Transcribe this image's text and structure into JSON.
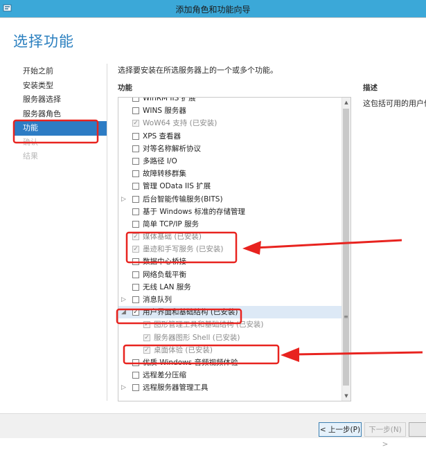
{
  "window": {
    "title": "添加角色和功能向导"
  },
  "page": {
    "title": "选择功能",
    "instruction": "选择要安装在所选服务器上的一个或多个功能。"
  },
  "nav": {
    "items": [
      {
        "label": "开始之前",
        "state": "normal"
      },
      {
        "label": "安装类型",
        "state": "normal"
      },
      {
        "label": "服务器选择",
        "state": "normal"
      },
      {
        "label": "服务器角色",
        "state": "normal"
      },
      {
        "label": "功能",
        "state": "selected"
      },
      {
        "label": "确认",
        "state": "disabled"
      },
      {
        "label": "结果",
        "state": "disabled"
      }
    ]
  },
  "features": {
    "header": "功能",
    "items": [
      {
        "label": "WinRM IIS 扩展",
        "checked": false,
        "disabled": false,
        "indent": 0,
        "expander": ""
      },
      {
        "label": "WINS 服务器",
        "checked": false,
        "disabled": false,
        "indent": 0,
        "expander": ""
      },
      {
        "label": "WoW64 支持 (已安装)",
        "checked": true,
        "disabled": true,
        "indent": 0,
        "expander": ""
      },
      {
        "label": "XPS 查看器",
        "checked": false,
        "disabled": false,
        "indent": 0,
        "expander": ""
      },
      {
        "label": "对等名称解析协议",
        "checked": false,
        "disabled": false,
        "indent": 0,
        "expander": ""
      },
      {
        "label": "多路径 I/O",
        "checked": false,
        "disabled": false,
        "indent": 0,
        "expander": ""
      },
      {
        "label": "故障转移群集",
        "checked": false,
        "disabled": false,
        "indent": 0,
        "expander": ""
      },
      {
        "label": "管理 OData IIS 扩展",
        "checked": false,
        "disabled": false,
        "indent": 0,
        "expander": ""
      },
      {
        "label": "后台智能传输服务(BITS)",
        "checked": false,
        "disabled": false,
        "indent": 0,
        "expander": "collapsed"
      },
      {
        "label": "基于 Windows 标准的存储管理",
        "checked": false,
        "disabled": false,
        "indent": 0,
        "expander": ""
      },
      {
        "label": "简单 TCP/IP 服务",
        "checked": false,
        "disabled": false,
        "indent": 0,
        "expander": ""
      },
      {
        "label": "媒体基础 (已安装)",
        "checked": true,
        "disabled": true,
        "indent": 0,
        "expander": ""
      },
      {
        "label": "墨迹和手写服务 (已安装)",
        "checked": true,
        "disabled": true,
        "indent": 0,
        "expander": ""
      },
      {
        "label": "数据中心桥接",
        "checked": false,
        "disabled": false,
        "indent": 0,
        "expander": ""
      },
      {
        "label": "网络负载平衡",
        "checked": false,
        "disabled": false,
        "indent": 0,
        "expander": ""
      },
      {
        "label": "无线 LAN 服务",
        "checked": false,
        "disabled": false,
        "indent": 0,
        "expander": ""
      },
      {
        "label": "消息队列",
        "checked": false,
        "disabled": false,
        "indent": 0,
        "expander": "collapsed"
      },
      {
        "label": "用户界面和基础结构 (已安装)",
        "checked": true,
        "disabled": false,
        "indent": 0,
        "expander": "expanded",
        "highlight": true
      },
      {
        "label": "图形管理工具和基础结构 (已安装)",
        "checked": true,
        "disabled": true,
        "indent": 1,
        "expander": ""
      },
      {
        "label": "服务器图形 Shell (已安装)",
        "checked": true,
        "disabled": true,
        "indent": 1,
        "expander": ""
      },
      {
        "label": "桌面体验 (已安装)",
        "checked": true,
        "disabled": true,
        "indent": 1,
        "expander": ""
      },
      {
        "label": "优质 Windows 音频视频体验",
        "checked": false,
        "disabled": false,
        "indent": 0,
        "expander": ""
      },
      {
        "label": "远程差分压缩",
        "checked": false,
        "disabled": false,
        "indent": 0,
        "expander": ""
      },
      {
        "label": "远程服务器管理工具",
        "checked": false,
        "disabled": false,
        "indent": 0,
        "expander": "collapsed"
      }
    ]
  },
  "description": {
    "header": "描述",
    "text": "这包括可用的用户体验"
  },
  "footer": {
    "prev_label": "< 上一步(P)",
    "next_label": "下一步(N) >"
  },
  "colors": {
    "titlebar": "#3ba8d8",
    "title_accent": "#2a7fbf",
    "selection": "#2d7cc4",
    "annotation_red": "#e8231f"
  }
}
